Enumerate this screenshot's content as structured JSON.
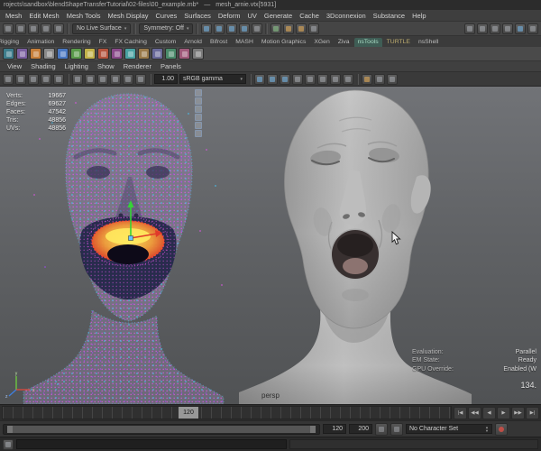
{
  "titlebar": {
    "path": "rojects\\sandbox\\blendShapeTransferTutorial\\02-files\\00_example.mb*",
    "separator": "—",
    "selection": "mesh_arnie.vtx[5931]"
  },
  "menubar": {
    "items": [
      "Mesh",
      "Edit Mesh",
      "Mesh Tools",
      "Mesh Display",
      "Curves",
      "Surfaces",
      "Deform",
      "UV",
      "Generate",
      "Cache",
      "3Dconnexion",
      "Substance",
      "Help"
    ]
  },
  "statusline": {
    "live_surface": "No Live Surface",
    "symmetry": "Symmetry: Off"
  },
  "shelf": {
    "tabs": [
      "Rigging",
      "Animation",
      "Rendering",
      "FX",
      "FX Caching",
      "Custom",
      "Arnold",
      "Bifrost",
      "MASH",
      "Motion Graphics",
      "XGen",
      "Ziva",
      "nsTools",
      "TURTLE",
      "nsShell"
    ],
    "active_tab": "nsTools"
  },
  "panel_menubar": {
    "items": [
      "View",
      "Shading",
      "Lighting",
      "Show",
      "Renderer",
      "Panels"
    ]
  },
  "panel_toolbar": {
    "exposure": "1.00",
    "gamma": "sRGB gamma"
  },
  "viewport": {
    "camera": "persp",
    "stats": [
      {
        "label": "Verts:",
        "value": "19667"
      },
      {
        "label": "Edges:",
        "value": "69627"
      },
      {
        "label": "Faces:",
        "value": "47542"
      },
      {
        "label": "Tris:",
        "value": "48856"
      },
      {
        "label": "UVs:",
        "value": "48856"
      }
    ],
    "eval": [
      {
        "label": "Evaluation:",
        "value": "Parallel"
      },
      {
        "label": "EM State:",
        "value": "Ready"
      },
      {
        "label": "GPU Override:",
        "value": "Enabled (W"
      }
    ],
    "fps": "134."
  },
  "timeline": {
    "current_frame": "120"
  },
  "range": {
    "start": "120",
    "end": "200",
    "character_set": "No Character Set"
  },
  "colors": {
    "vertex_magenta": "#d857e0",
    "vertex_cyan": "#49c0ee",
    "selection_yellow": "#ffe95e",
    "selection_red": "#e03a26",
    "active_tab": "#a8dcc4"
  }
}
